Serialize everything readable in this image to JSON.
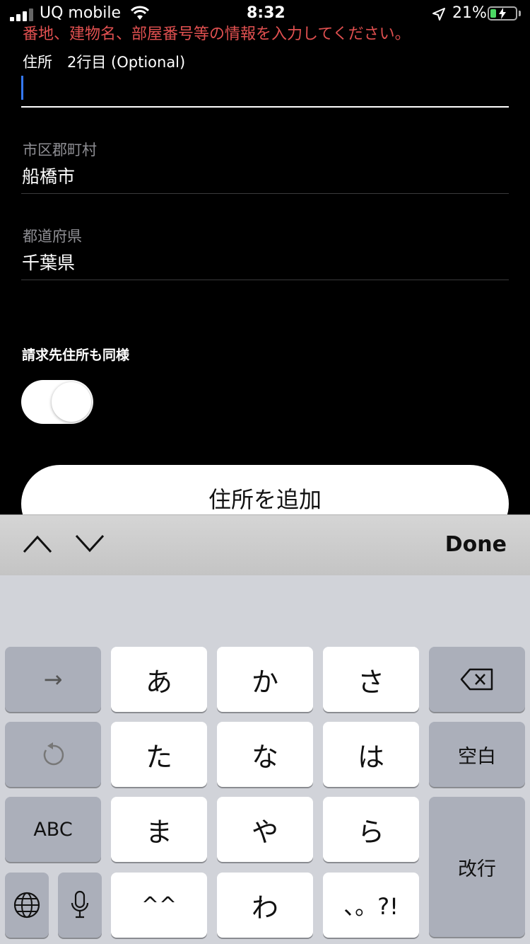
{
  "status_bar": {
    "carrier": "UQ mobile",
    "time": "8:32",
    "battery": "21%"
  },
  "error_message": "番地、建物名、部屋番号等の情報を入力してください。",
  "address_line2": {
    "label": "住所　2行目 (Optional)",
    "value": ""
  },
  "city": {
    "label": "市区郡町村",
    "value": "船橋市"
  },
  "prefecture": {
    "label": "都道府県",
    "value": "千葉県"
  },
  "billing_same": {
    "label": "請求先住所も同様",
    "on": true
  },
  "add_address_button": "住所を追加",
  "accessory": {
    "done_label": "Done"
  },
  "keyboard": {
    "keys": {
      "a": "あ",
      "ka": "か",
      "sa": "さ",
      "ta": "た",
      "na": "な",
      "ha": "は",
      "ma": "ま",
      "ya": "や",
      "ra": "ら",
      "emoji": "^^",
      "wa": "わ",
      "punct": "、。?!",
      "space": "空白",
      "abc": "ABC",
      "return": "改行",
      "arrow": "→"
    }
  },
  "colors": {
    "error": "#e05050",
    "caret": "#3478f6",
    "battery_fill": "#4cd964"
  }
}
